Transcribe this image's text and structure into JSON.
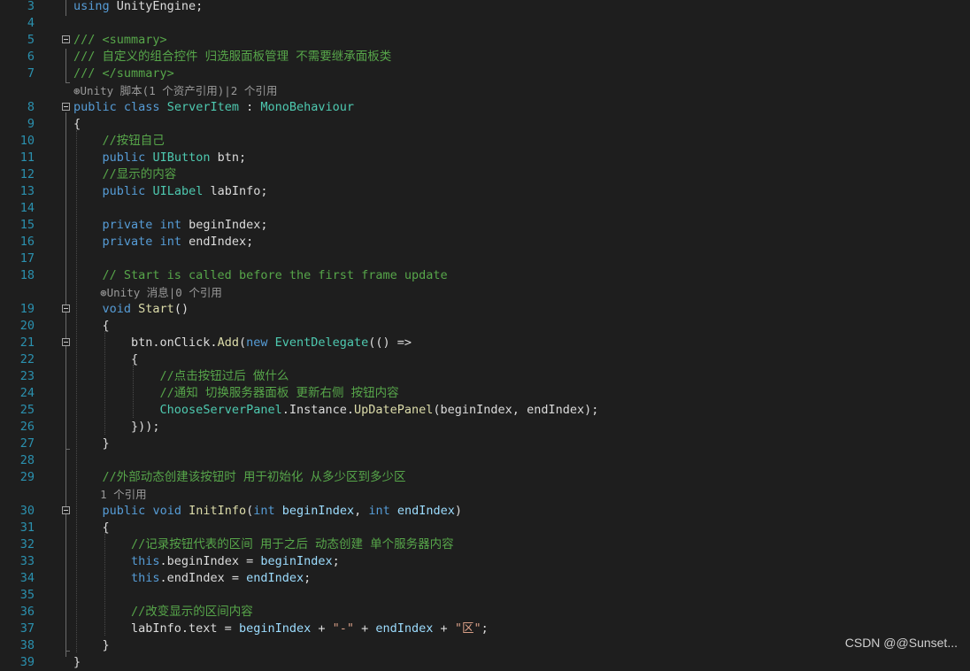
{
  "editor": {
    "lines": [
      {
        "n": "3",
        "tokens": [
          {
            "t": "using",
            "c": "kw"
          },
          {
            "t": " UnityEngine;",
            "c": "pl"
          }
        ]
      },
      {
        "n": "4",
        "tokens": []
      },
      {
        "n": "5",
        "fold": true,
        "tokens": [
          {
            "t": "/// <summary>",
            "c": "cm"
          }
        ]
      },
      {
        "n": "6",
        "tokens": [
          {
            "t": "/// 自定义的组合控件 归选服面板管理 不需要继承面板类",
            "c": "cm"
          }
        ]
      },
      {
        "n": "7",
        "tokens": [
          {
            "t": "/// </summary>",
            "c": "cm"
          }
        ]
      },
      {
        "lens": "⊛Unity 脚本(1 个资产引用)|2 个引用"
      },
      {
        "n": "8",
        "fold": true,
        "tokens": [
          {
            "t": "public",
            "c": "kw"
          },
          {
            "t": " ",
            "c": "pl"
          },
          {
            "t": "class",
            "c": "kw"
          },
          {
            "t": " ",
            "c": "pl"
          },
          {
            "t": "ServerItem",
            "c": "type"
          },
          {
            "t": " : ",
            "c": "pl"
          },
          {
            "t": "MonoBehaviour",
            "c": "type"
          }
        ]
      },
      {
        "n": "9",
        "tokens": [
          {
            "t": "{",
            "c": "pl"
          }
        ]
      },
      {
        "n": "10",
        "tokens": [
          {
            "t": "    ",
            "c": "pl"
          },
          {
            "t": "//按钮自己",
            "c": "cm"
          }
        ]
      },
      {
        "n": "11",
        "tokens": [
          {
            "t": "    ",
            "c": "pl"
          },
          {
            "t": "public",
            "c": "kw"
          },
          {
            "t": " ",
            "c": "pl"
          },
          {
            "t": "UIButton",
            "c": "type"
          },
          {
            "t": " btn;",
            "c": "pl"
          }
        ]
      },
      {
        "n": "12",
        "tokens": [
          {
            "t": "    ",
            "c": "pl"
          },
          {
            "t": "//显示的内容",
            "c": "cm"
          }
        ]
      },
      {
        "n": "13",
        "tokens": [
          {
            "t": "    ",
            "c": "pl"
          },
          {
            "t": "public",
            "c": "kw"
          },
          {
            "t": " ",
            "c": "pl"
          },
          {
            "t": "UILabel",
            "c": "type"
          },
          {
            "t": " labInfo;",
            "c": "pl"
          }
        ]
      },
      {
        "n": "14",
        "tokens": []
      },
      {
        "n": "15",
        "tokens": [
          {
            "t": "    ",
            "c": "pl"
          },
          {
            "t": "private",
            "c": "kw"
          },
          {
            "t": " ",
            "c": "pl"
          },
          {
            "t": "int",
            "c": "kw"
          },
          {
            "t": " beginIndex;",
            "c": "pl"
          }
        ]
      },
      {
        "n": "16",
        "tokens": [
          {
            "t": "    ",
            "c": "pl"
          },
          {
            "t": "private",
            "c": "kw"
          },
          {
            "t": " ",
            "c": "pl"
          },
          {
            "t": "int",
            "c": "kw"
          },
          {
            "t": " endIndex;",
            "c": "pl"
          }
        ]
      },
      {
        "n": "17",
        "tokens": []
      },
      {
        "n": "18",
        "tokens": [
          {
            "t": "    ",
            "c": "pl"
          },
          {
            "t": "// Start is called before the first frame update",
            "c": "cm"
          }
        ]
      },
      {
        "lens": "    ⊛Unity 消息|0 个引用"
      },
      {
        "n": "19",
        "fold": true,
        "tokens": [
          {
            "t": "    ",
            "c": "pl"
          },
          {
            "t": "void",
            "c": "kw"
          },
          {
            "t": " ",
            "c": "pl"
          },
          {
            "t": "Start",
            "c": "fn"
          },
          {
            "t": "()",
            "c": "pl"
          }
        ]
      },
      {
        "n": "20",
        "tokens": [
          {
            "t": "    {",
            "c": "pl"
          }
        ]
      },
      {
        "n": "21",
        "fold": true,
        "tokens": [
          {
            "t": "        btn.onClick.",
            "c": "pl"
          },
          {
            "t": "Add",
            "c": "fn"
          },
          {
            "t": "(",
            "c": "pl"
          },
          {
            "t": "new",
            "c": "kw"
          },
          {
            "t": " ",
            "c": "pl"
          },
          {
            "t": "EventDelegate",
            "c": "type"
          },
          {
            "t": "(() =>",
            "c": "pl"
          }
        ]
      },
      {
        "n": "22",
        "tokens": [
          {
            "t": "        {",
            "c": "pl"
          }
        ]
      },
      {
        "n": "23",
        "tokens": [
          {
            "t": "            ",
            "c": "pl"
          },
          {
            "t": "//点击按钮过后 做什么",
            "c": "cm"
          }
        ]
      },
      {
        "n": "24",
        "tokens": [
          {
            "t": "            ",
            "c": "pl"
          },
          {
            "t": "//通知 切换服务器面板 更新右侧 按钮内容",
            "c": "cm"
          }
        ]
      },
      {
        "n": "25",
        "tokens": [
          {
            "t": "            ",
            "c": "pl"
          },
          {
            "t": "ChooseServerPanel",
            "c": "type"
          },
          {
            "t": ".Instance.",
            "c": "pl"
          },
          {
            "t": "UpDatePanel",
            "c": "fn"
          },
          {
            "t": "(beginIndex, endIndex);",
            "c": "pl"
          }
        ]
      },
      {
        "n": "26",
        "tokens": [
          {
            "t": "        }));",
            "c": "pl"
          }
        ]
      },
      {
        "n": "27",
        "tokens": [
          {
            "t": "    }",
            "c": "pl"
          }
        ]
      },
      {
        "n": "28",
        "tokens": []
      },
      {
        "n": "29",
        "tokens": [
          {
            "t": "    ",
            "c": "pl"
          },
          {
            "t": "//外部动态创建该按钮时 用于初始化 从多少区到多少区",
            "c": "cm"
          }
        ]
      },
      {
        "lens": "    1 个引用"
      },
      {
        "n": "30",
        "fold": true,
        "tokens": [
          {
            "t": "    ",
            "c": "pl"
          },
          {
            "t": "public",
            "c": "kw"
          },
          {
            "t": " ",
            "c": "pl"
          },
          {
            "t": "void",
            "c": "kw"
          },
          {
            "t": " ",
            "c": "pl"
          },
          {
            "t": "InitInfo",
            "c": "fn"
          },
          {
            "t": "(",
            "c": "pl"
          },
          {
            "t": "int",
            "c": "kw"
          },
          {
            "t": " ",
            "c": "pl"
          },
          {
            "t": "beginIndex",
            "c": "var"
          },
          {
            "t": ", ",
            "c": "pl"
          },
          {
            "t": "int",
            "c": "kw"
          },
          {
            "t": " ",
            "c": "pl"
          },
          {
            "t": "endIndex",
            "c": "var"
          },
          {
            "t": ")",
            "c": "pl"
          }
        ]
      },
      {
        "n": "31",
        "tokens": [
          {
            "t": "    {",
            "c": "pl"
          }
        ]
      },
      {
        "n": "32",
        "tokens": [
          {
            "t": "        ",
            "c": "pl"
          },
          {
            "t": "//记录按钮代表的区间 用于之后 动态创建 单个服务器内容",
            "c": "cm"
          }
        ]
      },
      {
        "n": "33",
        "tokens": [
          {
            "t": "        ",
            "c": "pl"
          },
          {
            "t": "this",
            "c": "kw"
          },
          {
            "t": ".beginIndex = ",
            "c": "pl"
          },
          {
            "t": "beginIndex",
            "c": "var"
          },
          {
            "t": ";",
            "c": "pl"
          }
        ]
      },
      {
        "n": "34",
        "tokens": [
          {
            "t": "        ",
            "c": "pl"
          },
          {
            "t": "this",
            "c": "kw"
          },
          {
            "t": ".endIndex = ",
            "c": "pl"
          },
          {
            "t": "endIndex",
            "c": "var"
          },
          {
            "t": ";",
            "c": "pl"
          }
        ]
      },
      {
        "n": "35",
        "tokens": []
      },
      {
        "n": "36",
        "tokens": [
          {
            "t": "        ",
            "c": "pl"
          },
          {
            "t": "//改变显示的区间内容",
            "c": "cm"
          }
        ]
      },
      {
        "n": "37",
        "tokens": [
          {
            "t": "        labInfo.text = ",
            "c": "pl"
          },
          {
            "t": "beginIndex",
            "c": "var"
          },
          {
            "t": " + ",
            "c": "pl"
          },
          {
            "t": "\"-\"",
            "c": "str"
          },
          {
            "t": " + ",
            "c": "pl"
          },
          {
            "t": "endIndex",
            "c": "var"
          },
          {
            "t": " + ",
            "c": "pl"
          },
          {
            "t": "\"区\"",
            "c": "str"
          },
          {
            "t": ";",
            "c": "pl"
          }
        ]
      },
      {
        "n": "38",
        "tokens": [
          {
            "t": "    }",
            "c": "pl"
          }
        ]
      },
      {
        "n": "39",
        "tokens": [
          {
            "t": "}",
            "c": "pl"
          }
        ]
      }
    ]
  },
  "watermark": "CSDN @@Sunset...",
  "colors": {
    "background": "#1e1e1e",
    "line_number": "#2b91af",
    "keyword": "#569cd6",
    "type": "#4ec9b0",
    "comment": "#57a64a",
    "parameter": "#9cdcfe",
    "method": "#dcdcaa",
    "string": "#d69d85",
    "plain": "#dcdcdc",
    "codelens": "#999999"
  }
}
